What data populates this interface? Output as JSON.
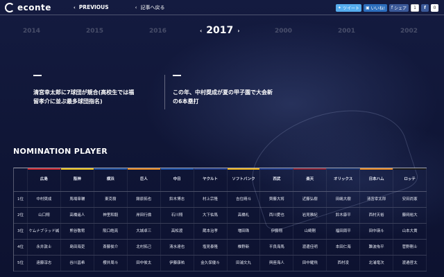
{
  "header": {
    "logo": "econte",
    "prev_label": "PREVIOUS",
    "back_label": "記事へ戻る",
    "social": {
      "tweet": "ツイート",
      "hatena": "いいね!",
      "fb_share": "シェア",
      "fb_count": "1",
      "f": "f",
      "zero": "0"
    }
  },
  "years": {
    "left": [
      "2014",
      "2015",
      "2016"
    ],
    "current": "2017",
    "right": [
      "2000",
      "2001",
      "2002"
    ]
  },
  "articles": [
    {
      "line1": "清宮幸太郎に7球団が競合(高校生では福",
      "line2": "留孝介に並ぶ最多球団指名)"
    },
    {
      "line1": "この年、中村奨成が夏の甲子園で大会新",
      "line2": "の6本塁打"
    }
  ],
  "nomination": {
    "title": "NOMINATION PLAYER",
    "teams": [
      {
        "name": "広島",
        "color": "#d1242b"
      },
      {
        "name": "阪神",
        "color": "#f4c81b"
      },
      {
        "name": "横浜",
        "color": "#1d4fa0"
      },
      {
        "name": "巨人",
        "color": "#f08c1e"
      },
      {
        "name": "中日",
        "color": "#1a4fa8"
      },
      {
        "name": "ヤクルト",
        "color": "#1e3a8a"
      },
      {
        "name": "ソフトバンク",
        "color": "#f4b71a"
      },
      {
        "name": "西武",
        "color": "#1e3a8a"
      },
      {
        "name": "楽天",
        "color": "#8a1e32"
      },
      {
        "name": "オリックス",
        "color": "#17306b"
      },
      {
        "name": "日本ハム",
        "color": "#f08c1e"
      },
      {
        "name": "ロッテ",
        "color": "#1a1a1a"
      }
    ],
    "rows": [
      {
        "rank": "1位",
        "players": [
          "中村奨成",
          "馬場皐輔",
          "東克樹",
          "鍬原拓也",
          "鈴木博志",
          "村上宗隆",
          "吉住晴斗",
          "齊藤大将",
          "近藤弘樹",
          "田嶋大樹",
          "清宮幸太郎",
          "安田尚憲"
        ]
      },
      {
        "rank": "2位",
        "players": [
          "山口翔",
          "高橋遥人",
          "神里和毅",
          "岸田行倫",
          "石川翔",
          "大下佑馬",
          "高橋礼",
          "西川愛也",
          "岩見雅紀",
          "鈴木康平",
          "西村天裕",
          "藤岡裕大"
        ]
      },
      {
        "rank": "3位",
        "players": [
          "ケムナブラッド誠",
          "熊谷敬宥",
          "阪口皓亮",
          "大城卓三",
          "高松渡",
          "蔵本治孝",
          "増田珠",
          "伊藤翔",
          "山崎剛",
          "福田周平",
          "田中瑛斗",
          "山本大貴"
        ]
      },
      {
        "rank": "4位",
        "players": [
          "永井敦士",
          "島田海吏",
          "斎藤俊介",
          "北村拓己",
          "清水達也",
          "塩見泰隆",
          "椎野新",
          "平良海馬",
          "渡邊佳明",
          "本田仁海",
          "難波侑平",
          "菅野剛士"
        ]
      },
      {
        "rank": "5位",
        "players": [
          "遠藤淳志",
          "谷川昌希",
          "櫻井周斗",
          "田中俊太",
          "伊藤康祐",
          "金久保優斗",
          "田浦文丸",
          "與座海人",
          "田中耀飛",
          "西村凌",
          "北浦竜次",
          "渡邉啓太"
        ]
      }
    ]
  }
}
